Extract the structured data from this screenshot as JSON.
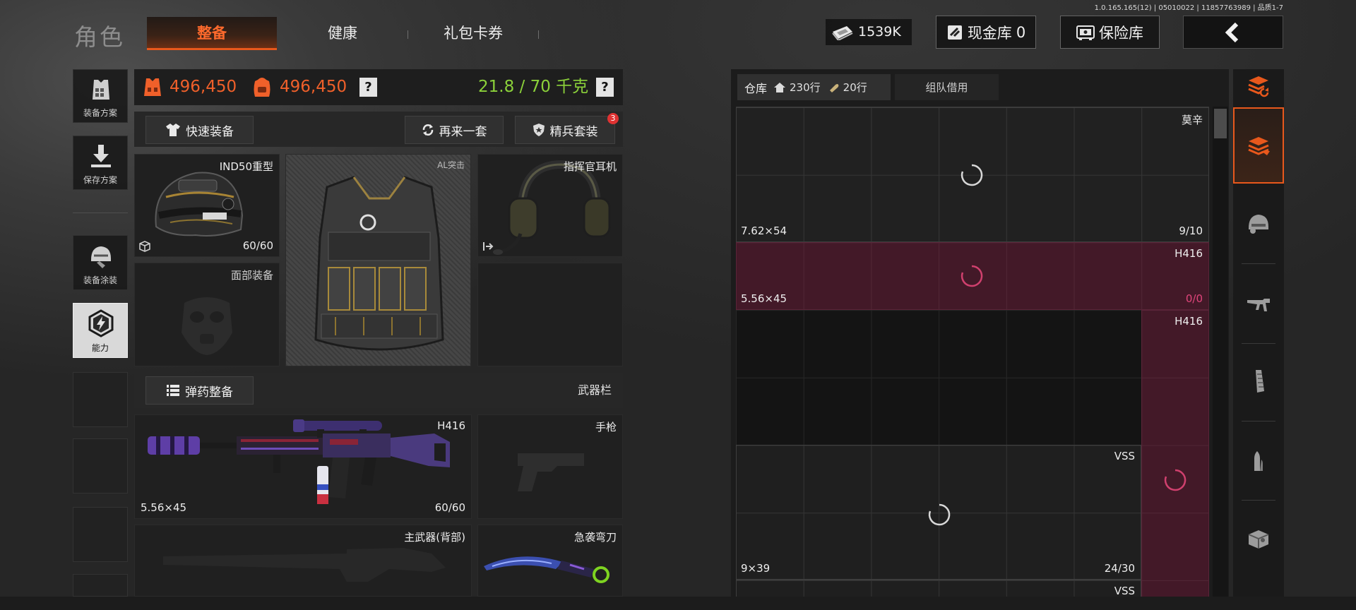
{
  "version": "1.0.165.165(12) | 05010022 | 11857763989 | 品质1-7",
  "header": {
    "title": "角色",
    "tabs": [
      {
        "label": "整备",
        "active": true
      },
      {
        "label": "健康",
        "active": false
      },
      {
        "label": "礼包卡券",
        "active": false
      }
    ],
    "money": {
      "icon": "cash-bundle-icon",
      "value": "1539K"
    },
    "cash_vault": {
      "icon": "cash-vault-icon",
      "label": "现金库",
      "value": "0"
    },
    "safe": {
      "icon": "safe-icon",
      "label": "保险库"
    },
    "back": {
      "icon": "back-chevron-icon"
    }
  },
  "sidebar": {
    "items": [
      {
        "label": "装备方案",
        "icon": "loadout-plan-icon"
      },
      {
        "label": "保存方案",
        "icon": "save-download-icon"
      },
      {
        "label": "装备涂装",
        "icon": "paint-helmet-icon"
      },
      {
        "label": "能力",
        "icon": "ability-hex-icon",
        "active": true
      }
    ]
  },
  "loadout": {
    "armor_value": "496,450",
    "bag_value": "496,450",
    "weight": "21.8 / 70 千克",
    "help": "?",
    "quick_equip": "快速装备",
    "repeat_set": "再来一套",
    "elite_set": "精兵套装",
    "elite_badge": "3",
    "slots": {
      "helmet": {
        "name": "IND50重型",
        "durability": "60/60"
      },
      "armor": {
        "name": "AL突击"
      },
      "headset": {
        "name": "指挥官耳机"
      },
      "face": {
        "name": "面部装备"
      }
    },
    "ammo_button": "弹药整备",
    "weapon_bar": "武器栏",
    "weapons": {
      "primary": {
        "name": "H416",
        "caliber": "5.56×45",
        "ammo": "60/60"
      },
      "pistol": {
        "name": "手枪"
      },
      "back": {
        "name": "主武器(背部)"
      },
      "melee": {
        "name": "急袭弯刀"
      }
    }
  },
  "warehouse": {
    "tab": "仓库",
    "rows_main": "230行",
    "rows_extra": "20行",
    "team_borrow": "组队借用",
    "items": [
      {
        "name": "莫辛",
        "caliber": "7.62×54",
        "count": "9/10"
      },
      {
        "name": "H416",
        "caliber": "5.56×45",
        "count": "0/0"
      },
      {
        "name": "H416"
      },
      {
        "name": "VSS",
        "caliber": "9×39",
        "count": "24/30"
      },
      {
        "name": "VSS"
      }
    ]
  },
  "categories": [
    {
      "icon": "warehouse-sort-icon"
    },
    {
      "icon": "all-items-icon",
      "active": true
    },
    {
      "icon": "helmet-icon"
    },
    {
      "icon": "rifle-icon"
    },
    {
      "icon": "magazine-icon"
    },
    {
      "icon": "bullet-icon"
    },
    {
      "icon": "attachment-box-icon"
    }
  ],
  "colors": {
    "accent": "#e8581c",
    "weight_ok": "#8bd13a",
    "empty_ammo": "#e0457b",
    "value": "#f0602a"
  }
}
